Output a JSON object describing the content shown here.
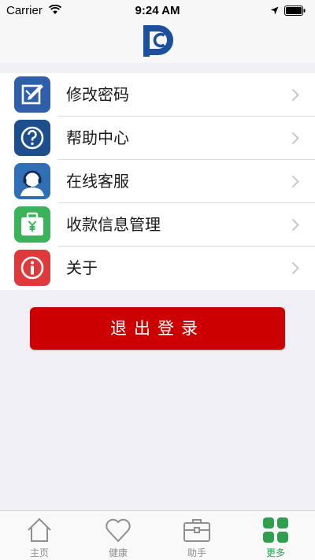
{
  "status": {
    "carrier": "Carrier",
    "time": "9:24 AM"
  },
  "colors": {
    "accent_green": "#2f9e4d",
    "logout_red": "#cc0000",
    "logo_blue": "#1c4f9c"
  },
  "menu": [
    {
      "label": "修改密码",
      "icon": "edit-icon",
      "color": "#2e5fa8"
    },
    {
      "label": "帮助中心",
      "icon": "help-icon",
      "color": "#1d4f8c"
    },
    {
      "label": "在线客服",
      "icon": "customer-service-icon",
      "color": "#2f6fb5"
    },
    {
      "label": "收款信息管理",
      "icon": "wallet-icon",
      "color": "#3bb35a"
    },
    {
      "label": "关于",
      "icon": "info-icon",
      "color": "#e0393b"
    }
  ],
  "logout_label": "退出登录",
  "tabs": [
    {
      "label": "主页",
      "icon": "home-icon",
      "active": false
    },
    {
      "label": "健康",
      "icon": "heart-icon",
      "active": false
    },
    {
      "label": "助手",
      "icon": "briefcase-icon",
      "active": false
    },
    {
      "label": "更多",
      "icon": "grid-icon",
      "active": true
    }
  ]
}
